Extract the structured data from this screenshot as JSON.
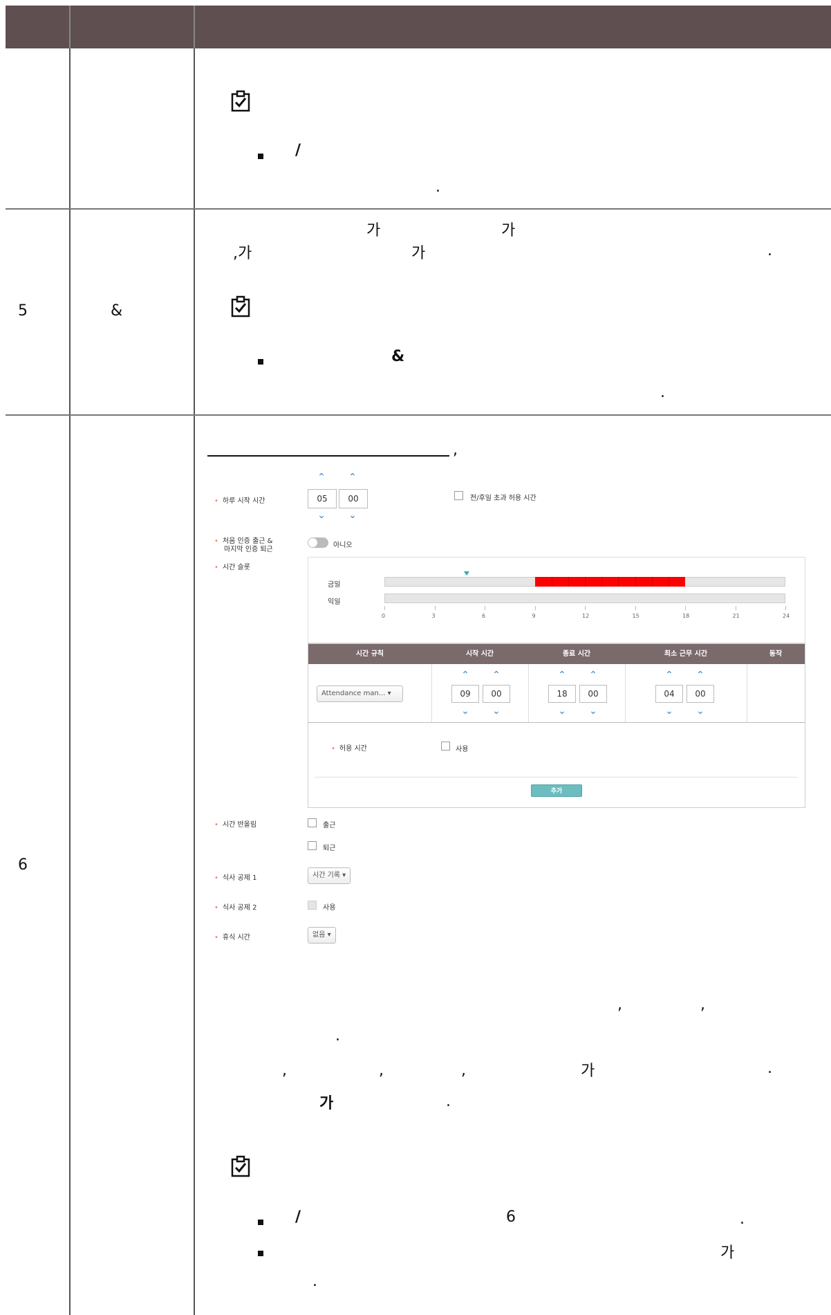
{
  "rows": [
    {
      "bullet_lines": [
        {
          "mark": "/"
        }
      ],
      "end_period": "."
    },
    {
      "number": "5",
      "title": "&",
      "para_line1_a": "가",
      "para_line1_b": "가",
      "para_line2_a": ",가",
      "para_line2_b": "가",
      "para_line2_end": ".",
      "bullet_mark": "&",
      "end_period": "."
    },
    {
      "number": "6",
      "heading_suffix": ",",
      "p1_c1": ",",
      "p1_c2": ",",
      "p1_end": ".",
      "p2_c1": ",",
      "p2_c2": ",",
      "p2_c3": ",",
      "p2_ga": "가",
      "p2_end": ".",
      "p3_ga": "가",
      "p3_end": ".",
      "b1_mark": "/",
      "b1_num": "6",
      "b1_end": ".",
      "b2_ga": "가",
      "b2_end": "."
    }
  ],
  "settings_ui": {
    "day_start_label": "하루 시작 시간",
    "day_start_hour": "05",
    "day_start_min": "00",
    "holiday_check_label": "전/후일 초과 허용 시간",
    "first_last_label_1": "처음 인증 출근 &",
    "first_last_label_2": "마지막 인증 퇴근",
    "toggle_text": "아니오",
    "time_slot_label": "시간 슬롯",
    "today_label": "금일",
    "next_day_label": "익일",
    "ticks": [
      "0",
      "3",
      "6",
      "9",
      "12",
      "15",
      "18",
      "21",
      "24"
    ],
    "slot_start_hour": 9,
    "slot_end_hour": 18,
    "slot_color": "#ff0000",
    "col_rule": "시간 규칙",
    "col_start": "시작 시간",
    "col_end": "종료 시간",
    "col_min": "최소 근무 시간",
    "col_action": "동작",
    "rule_select": "Attendance man...",
    "start_hour": "09",
    "start_min": "00",
    "end_hour": "18",
    "end_min": "00",
    "min_hour": "04",
    "min_min": "00",
    "allow_label": "허용 시간",
    "allow_check": "사용",
    "add_button": "추가",
    "rounding_label": "시간 반올림",
    "rounding_in": "출근",
    "rounding_out": "퇴근",
    "meal1_label": "식사 공제 1",
    "meal1_select": "시간 기록",
    "meal2_label": "식사 공제 2",
    "meal2_check": "사용",
    "break_label": "휴식 시간",
    "break_select": "없음",
    "header_color": "#7a6a6c",
    "accent_color": "#3a86c8",
    "button_color": "#6dbdc0"
  }
}
